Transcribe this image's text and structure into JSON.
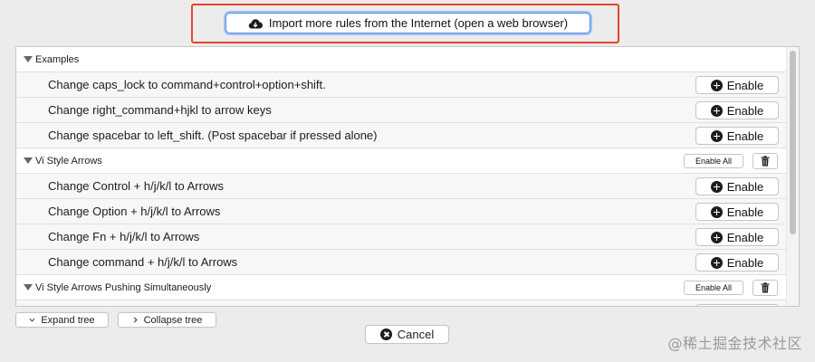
{
  "import_button": {
    "label": "Import more rules from the Internet (open a web browser)",
    "icon": "cloud-download-icon"
  },
  "highlight_color": "#e6462f",
  "groups": [
    {
      "title": "Examples",
      "show_actions": false,
      "rules": [
        {
          "label": "Change caps_lock to command+control+option+shift.",
          "button": "Enable"
        },
        {
          "label": "Change right_command+hjkl to arrow keys",
          "button": "Enable"
        },
        {
          "label": "Change spacebar to left_shift. (Post spacebar if pressed alone)",
          "button": "Enable"
        }
      ]
    },
    {
      "title": "Vi Style Arrows",
      "show_actions": true,
      "enable_all_label": "Enable All",
      "rules": [
        {
          "label": "Change Control + h/j/k/l to Arrows",
          "button": "Enable"
        },
        {
          "label": "Change Option + h/j/k/l to Arrows",
          "button": "Enable"
        },
        {
          "label": "Change Fn + h/j/k/l to Arrows",
          "button": "Enable"
        },
        {
          "label": "Change command + h/j/k/l to Arrows",
          "button": "Enable"
        }
      ]
    },
    {
      "title": "Vi Style Arrows Pushing Simultaneously",
      "show_actions": true,
      "enable_all_label": "Enable All",
      "rules": []
    }
  ],
  "expand_tree_label": "Expand tree",
  "collapse_tree_label": "Collapse tree",
  "cancel_label": "Cancel",
  "watermark": "@稀土掘金技术社区"
}
